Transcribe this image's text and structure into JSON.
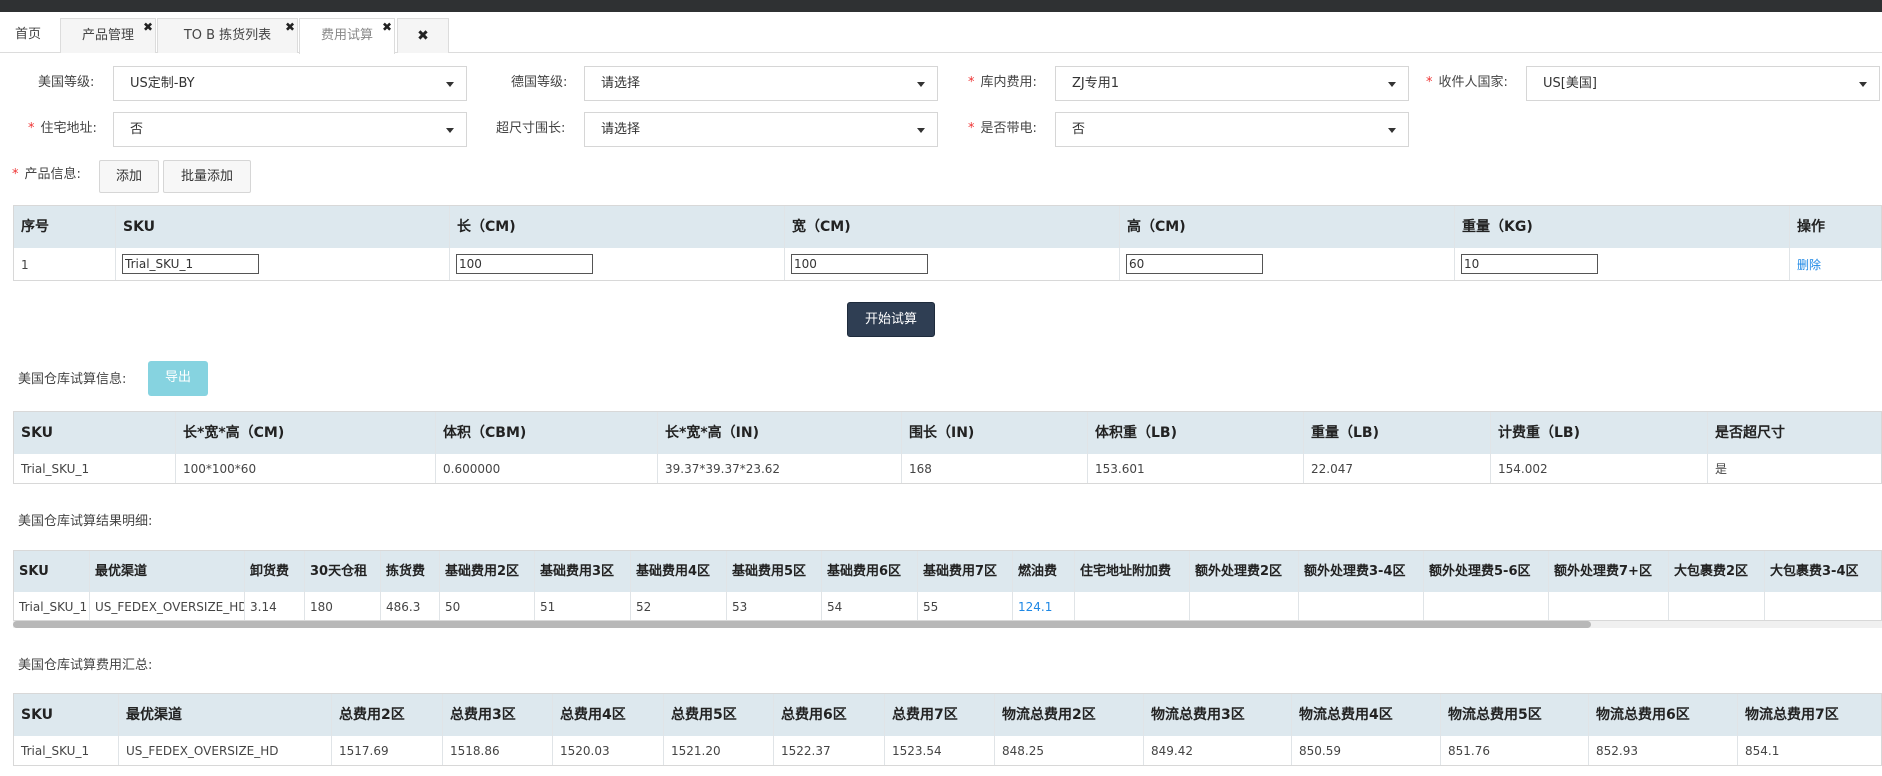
{
  "tabs": [
    {
      "label": "首页"
    },
    {
      "label": "产品管理"
    },
    {
      "label": "TO B 拣货列表"
    },
    {
      "label": "费用试算"
    }
  ],
  "close_all_label": "✖",
  "tab_close_glyph": "✖",
  "form": {
    "us_level": {
      "label": "美国等级:",
      "value": "US定制-BY"
    },
    "de_level": {
      "label": "德国等级:",
      "value": "请选择"
    },
    "warehouse_fee": {
      "label": "库内费用:",
      "value": "ZJ专用1"
    },
    "country": {
      "label": "收件人国家:",
      "value": "US[美国]"
    },
    "residential": {
      "label": "住宅地址:",
      "value": "否"
    },
    "oversize": {
      "label": "超尺寸围长:",
      "value": "请选择"
    },
    "battery": {
      "label": "是否带电:",
      "value": "否"
    },
    "required_mark": "*"
  },
  "product": {
    "label": "产品信息:",
    "add": "添加",
    "batch_add": "批量添加",
    "columns": [
      "序号",
      "SKU",
      "长（CM)",
      "宽（CM)",
      "高（CM)",
      "重量（KG)",
      "操作"
    ],
    "row": {
      "index": "1",
      "sku": "Trial_SKU_1",
      "length": "100",
      "width": "100",
      "height": "60",
      "weight": "10",
      "action": "删除"
    }
  },
  "start_button": "开始试算",
  "us_info": {
    "title": "美国仓库试算信息:",
    "export": "导出",
    "columns": [
      "SKU",
      "长*宽*高（CM)",
      "体积（CBM)",
      "长*宽*高（IN)",
      "围长（IN)",
      "体积重（LB)",
      "重量（LB)",
      "计费重（LB)",
      "是否超尺寸"
    ],
    "row": [
      "Trial_SKU_1",
      "100*100*60",
      "0.600000",
      "39.37*39.37*23.62",
      "168",
      "153.601",
      "22.047",
      "154.002",
      "是"
    ]
  },
  "us_detail": {
    "title": "美国仓库试算结果明细:",
    "columns": [
      "SKU",
      "最优渠道",
      "卸货费",
      "30天仓租",
      "拣货费",
      "基础费用2区",
      "基础费用3区",
      "基础费用4区",
      "基础费用5区",
      "基础费用6区",
      "基础费用7区",
      "燃油费",
      "住宅地址附加费",
      "额外处理费2区",
      "额外处理费3-4区",
      "额外处理费5-6区",
      "额外处理费7+区",
      "大包裹费2区",
      "大包裹费3-4区"
    ],
    "row": [
      "Trial_SKU_1",
      "US_FEDEX_OVERSIZE_HD",
      "3.14",
      "180",
      "486.3",
      "50",
      "51",
      "52",
      "53",
      "54",
      "55",
      "124.1",
      "",
      "",
      "",
      "",
      "",
      "",
      ""
    ]
  },
  "us_summary": {
    "title": "美国仓库试算费用汇总:",
    "columns": [
      "SKU",
      "最优渠道",
      "总费用2区",
      "总费用3区",
      "总费用4区",
      "总费用5区",
      "总费用6区",
      "总费用7区",
      "物流总费用2区",
      "物流总费用3区",
      "物流总费用4区",
      "物流总费用5区",
      "物流总费用6区",
      "物流总费用7区"
    ],
    "row": [
      "Trial_SKU_1",
      "US_FEDEX_OVERSIZE_HD",
      "1517.69",
      "1518.86",
      "1520.03",
      "1521.20",
      "1522.37",
      "1523.54",
      "848.25",
      "849.42",
      "850.59",
      "851.76",
      "852.93",
      "854.1"
    ]
  }
}
